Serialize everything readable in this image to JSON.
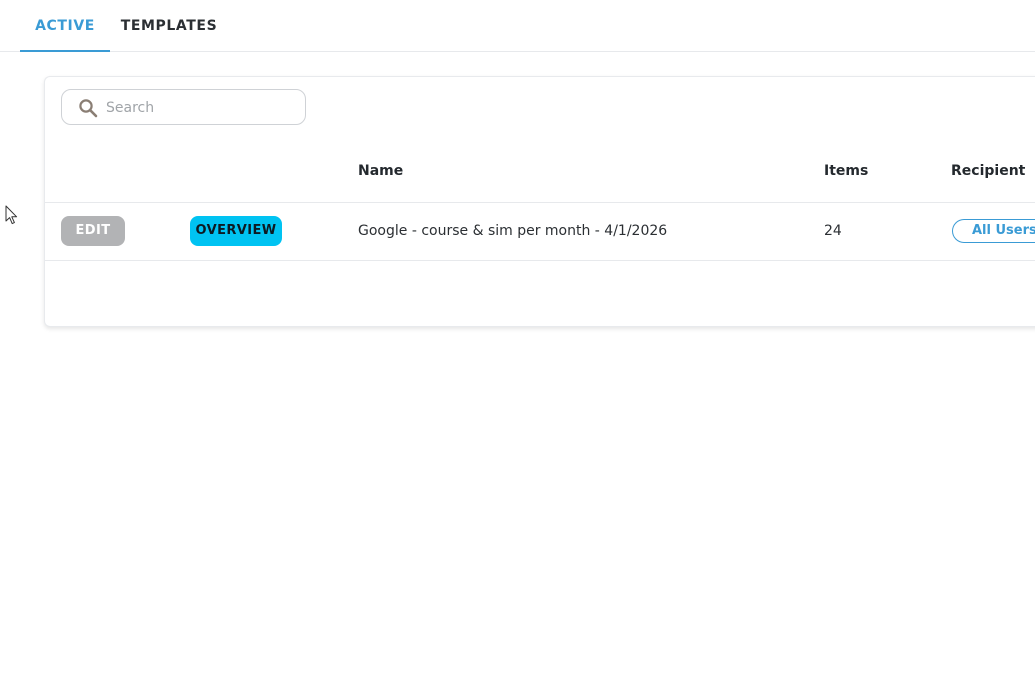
{
  "tabs": [
    {
      "label": "ACTIVE",
      "active": true
    },
    {
      "label": "TEMPLATES",
      "active": false
    }
  ],
  "search": {
    "placeholder": "Search",
    "value": "",
    "icon": "search-icon"
  },
  "table": {
    "columns": [
      "",
      "",
      "Name",
      "Items",
      "Recipient"
    ],
    "rows": [
      {
        "edit_label": "EDIT",
        "overview_label": "OVERVIEW",
        "name": "Google - course & sim per month - 4/1/2026",
        "items": "24",
        "recipient": "All Users"
      }
    ]
  },
  "colors": {
    "accent": "#3a9bd5",
    "overview_button": "#00c3f2",
    "edit_button": "#b2b3b5"
  }
}
